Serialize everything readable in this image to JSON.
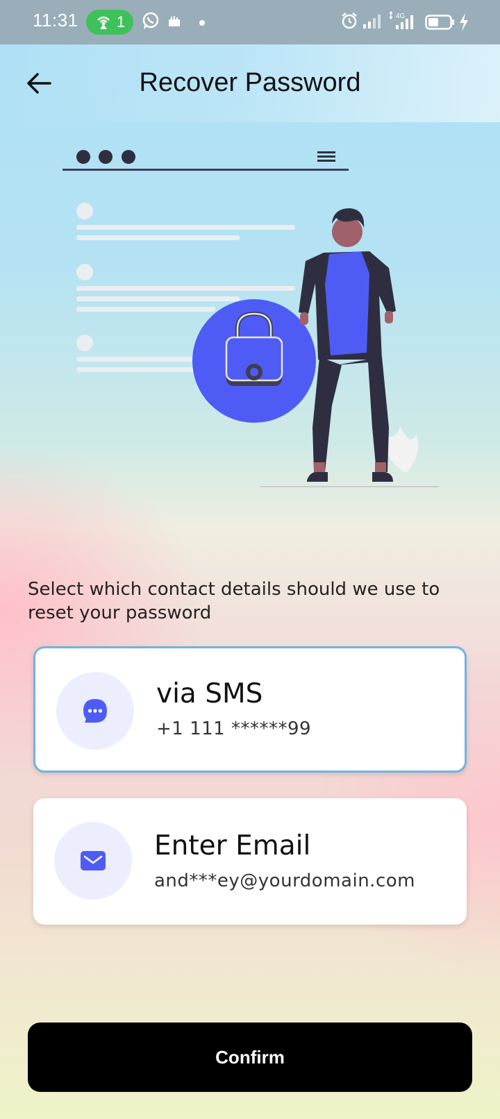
{
  "status_bar": {
    "time": "11:31",
    "hotspot_count": "1",
    "network": "4G",
    "icons": [
      "hotspot-icon",
      "whatsapp-icon",
      "notification-icon",
      "dot-icon",
      "alarm-icon",
      "signal-icon",
      "signal-4g-icon",
      "battery-icon",
      "charging-icon"
    ]
  },
  "header": {
    "title": "Recover Password",
    "back_icon": "arrow-left-icon"
  },
  "illustration": {
    "name": "lock-illustration"
  },
  "prompt": "Select which contact details should we use to reset your password",
  "options": [
    {
      "title": "via SMS",
      "value": "+1 111 ******99",
      "icon": "chat-bubble-icon",
      "selected": true
    },
    {
      "title": "Enter Email",
      "value": "and***ey@yourdomain.com",
      "icon": "mail-icon",
      "selected": false
    }
  ],
  "confirm_label": "Confirm",
  "colors": {
    "accent": "#4e5cf5",
    "icon_bg": "#eceefd",
    "selected_border": "#6fb3e6",
    "button": "#000000",
    "hotspot": "#3ec15b"
  }
}
